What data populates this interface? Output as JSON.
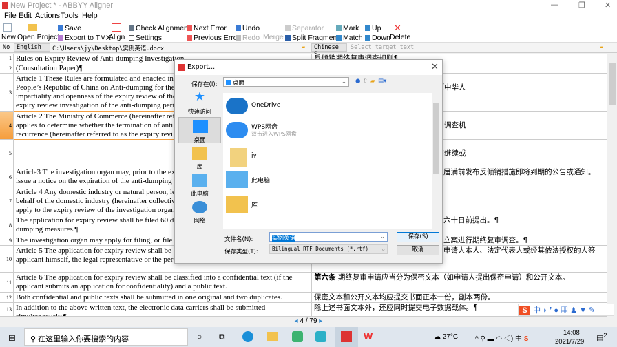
{
  "window": {
    "title": "New Project * - ABBYY Aligner"
  },
  "menu": [
    "File",
    "Edit",
    "Actions",
    "Tools",
    "Help"
  ],
  "toolbar": {
    "new": "New",
    "open_project": "Open Project",
    "save": "Save",
    "export_tmx": "Export to TMX",
    "align": "Align",
    "check_alignment": "Check Alignment",
    "settings": "Settings",
    "next_error": "Next Error",
    "previous_error": "Previous Error",
    "undo": "Undo",
    "redo": "Redo",
    "merge": "Merge",
    "separator": "Separator",
    "split_fragment": "Split Fragment",
    "mark": "Mark",
    "match": "Match",
    "up": "Up",
    "down": "Down",
    "delete": "Delete"
  },
  "langbar": {
    "no": "No",
    "source_lang": "English",
    "source_path": "C:\\Users\\jy\\Desktop\\实例英语.docx",
    "target_lang": "Chinese S",
    "target_placeholder": "Select target text"
  },
  "rows": [
    {
      "n": "1",
      "src": "Rules on Expiry Review of Anti-dumping Investigation",
      "tgt": "反倾销期终复审调查规则¶"
    },
    {
      "n": "2",
      "src": "(Consultation Paper)¶",
      "tgt": ""
    },
    {
      "n": "3",
      "src": "Article 1 These Rules are formulated and enacted in\nPeople’s Republic of China on Anti-dumping for the\nimpartiality and openness of the expiry review of the\nexpiry review investigation of the anti-dumping peri",
      "tgt": "\n公开，规范反倾销期终复审调查，根据《中华人\n规则。¶"
    },
    {
      "n": "4",
      "src": "Article 2 The Ministry of Commerce (hereinafter ref\napplies to determine whether the termination of anti\nrecurrence (hereinafter referred to as the expiry revi",
      "tgt": "\n人或有关组织（以下统称申请人）可以向调查机"
    },
    {
      "n": "5",
      "src": "",
      "tgt": "\n终止反倾销措施是否可能导致倾销和损害继续或\n审），适用本规则。¶"
    },
    {
      "n": "6",
      "src": "Article3 The investigation organ may, prior to the ex\nissue a notice on the expiration of the anti-dumping",
      "tgt": "届满前发布反倾销措施即将到期的公告或通知。"
    },
    {
      "n": "7",
      "src": "Article 4 Any domestic industry or natural person, le\nbehalf of the domestic industry (hereinafter collectiv\napply to the expiry review of the investigation organ",
      "tgt": ""
    },
    {
      "n": "8",
      "src": "The application for expiry review shall be filed 60 d\ndumping measures.¶",
      "tgt": "六十日前提出。¶"
    },
    {
      "n": "9",
      "src": "The investigation organ may apply for filing, or file i",
      "tgt": "立案进行期终复审调查。¶"
    },
    {
      "n": "10",
      "src": "Article 5 The application for expiry review shall be s\napplicant himself, the legal representative or the per",
      "tgt": "申请人本人、法定代表人或经其依法授权的人签\n署。¶"
    },
    {
      "n": "11",
      "src": "Article 6 The application for expiry review shall be classified into a confidential text (if the\napplicant submits an application for confidentiality) and a public text.",
      "tgt_bold": "第六条",
      "tgt": " 期终复审申请应当分为保密文本（如申请人提出保密申请）和公开文本。"
    },
    {
      "n": "12",
      "src": "Both confidential and public texts shall be submitted in one original and two duplicates.",
      "tgt": "保密文本和公开文本均应提交书面正本一份，副本两份。"
    },
    {
      "n": "13",
      "src": "In addition to the above written text, the electronic data carriers shall be submitted\nsimultaneously.¶",
      "tgt": "除上述书面文本外，还应同时提交电子数据载体。¶"
    }
  ],
  "pager": "4 / 79",
  "dialog": {
    "title": "Export...",
    "save_in_label": "保存在(I):",
    "save_in_value": "桌面",
    "places": [
      "快速访问",
      "桌面",
      "库",
      "此电脑",
      "网络"
    ],
    "files": [
      {
        "name": "OneDrive",
        "icon": "onedrive-icon"
      },
      {
        "name": "WPS网盘",
        "sub": "双击进入WPS网盘",
        "icon": "cloud-icon"
      },
      {
        "name": "jy",
        "icon": "user-folder-icon"
      },
      {
        "name": "此电脑",
        "icon": "computer-icon"
      },
      {
        "name": "库",
        "icon": "library-icon"
      }
    ],
    "filename_label": "文件名(N):",
    "filename_value": "实例英语",
    "filetype_label": "保存类型(T):",
    "filetype_value": "Bilingual RTF Documents (*.rtf)",
    "save_button": "保存(S)",
    "cancel_button": "取消"
  },
  "ime": {
    "label": "中"
  },
  "taskbar": {
    "search_placeholder": "在这里输入你要搜索的内容",
    "weather": "27°C",
    "ime": "中",
    "time": "14:08",
    "date": "2021/7/29",
    "notifications": "2"
  },
  "colors": {
    "selected_row": "#f59d3c",
    "accent": "#0078d7"
  }
}
